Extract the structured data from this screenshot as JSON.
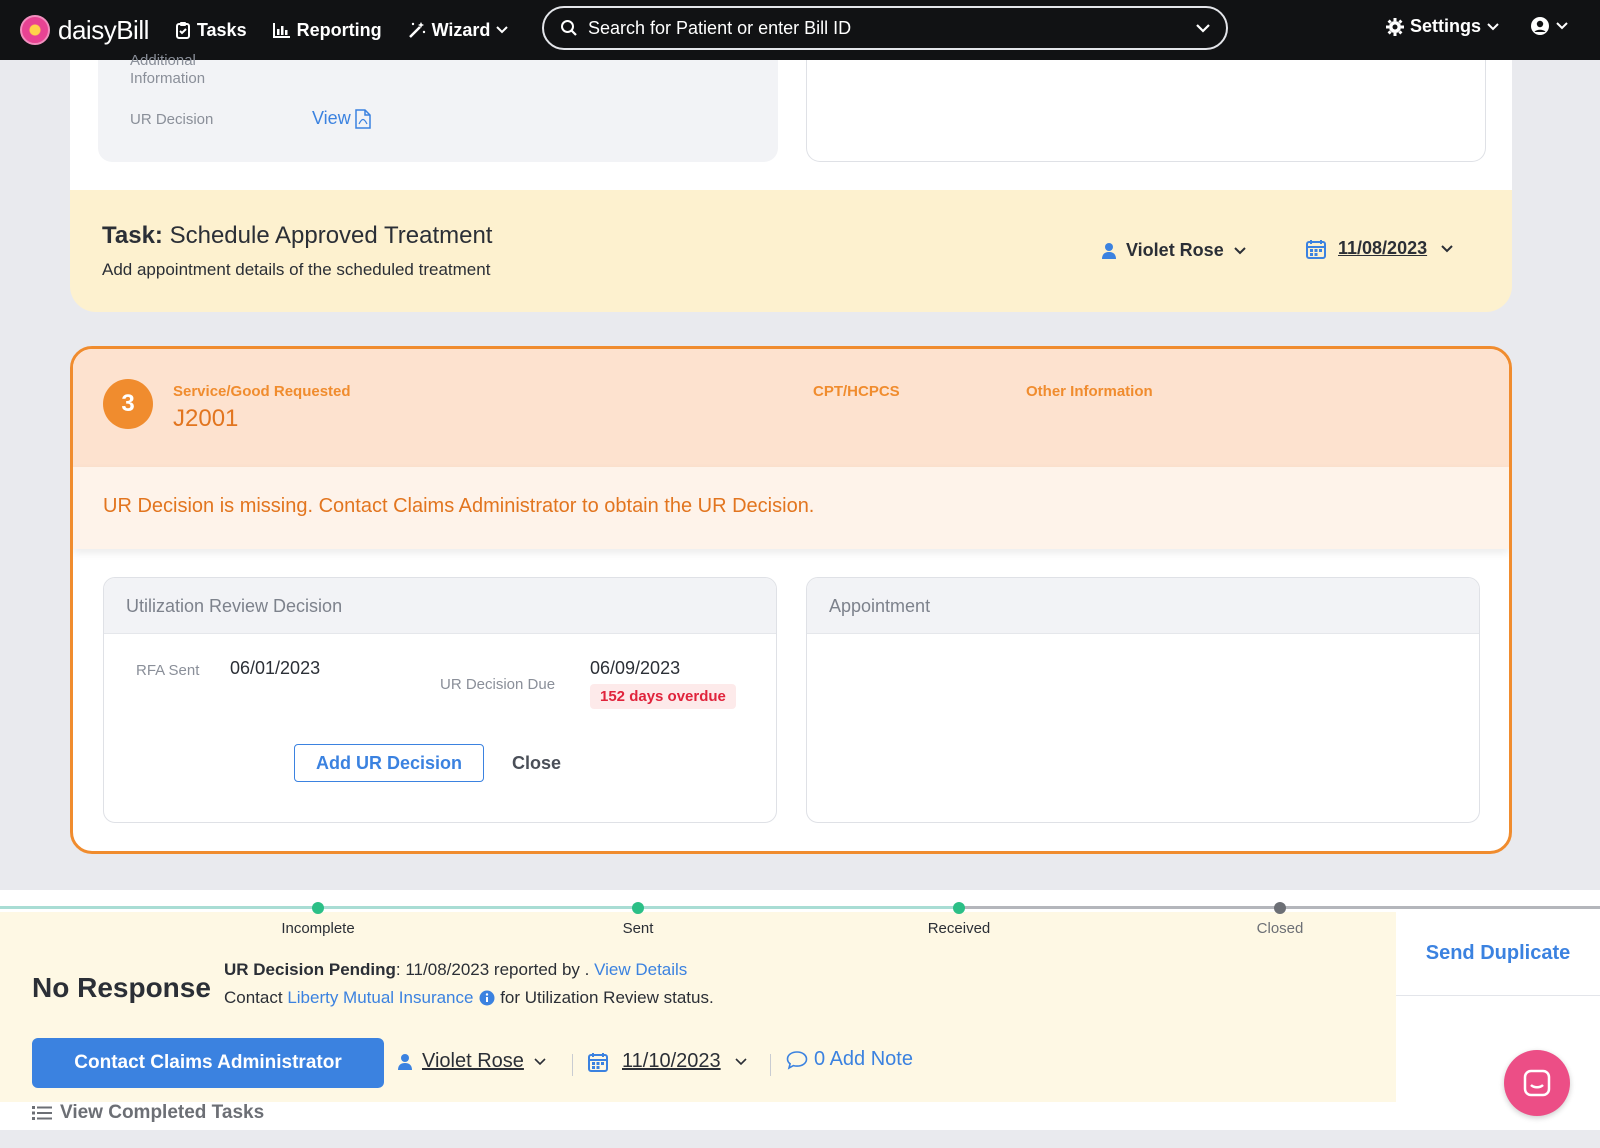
{
  "nav": {
    "brand": "daisyBill",
    "tasks": "Tasks",
    "reporting": "Reporting",
    "wizard": "Wizard",
    "search_placeholder": "Search for Patient or enter Bill ID",
    "settings": "Settings"
  },
  "prev_card": {
    "additional_information": "Additional Information",
    "ur_decision_label": "UR Decision",
    "view_link": "View"
  },
  "task": {
    "prefix": "Task:",
    "title": "Schedule Approved Treatment",
    "subtitle": "Add appointment details of the scheduled treatment",
    "assignee": "Violet Rose",
    "due_date": "11/08/2023"
  },
  "request": {
    "number": "3",
    "service_label": "Service/Good Requested",
    "service_value": "J2001",
    "cpt_label": "CPT/HCPCS",
    "other_label": "Other Information",
    "warning": "UR Decision is missing. Contact Claims Administrator to obtain the UR Decision.",
    "ur_panel": {
      "title": "Utilization Review Decision",
      "rfa_sent_label": "RFA Sent",
      "rfa_sent_value": "06/01/2023",
      "due_label": "UR Decision Due",
      "due_value": "06/09/2023",
      "overdue": "152 days overdue",
      "add_button": "Add UR Decision",
      "close_button": "Close"
    },
    "appointment_panel": {
      "title": "Appointment"
    }
  },
  "status": {
    "steps": [
      {
        "label": "Incomplete",
        "state": "done"
      },
      {
        "label": "Sent",
        "state": "done"
      },
      {
        "label": "Received",
        "state": "done"
      },
      {
        "label": "Closed",
        "state": "todo"
      }
    ],
    "title": "No Response",
    "pending_label": "UR Decision Pending",
    "pending_text": ": 11/08/2023 reported by . ",
    "view_details": "View Details",
    "contact_prefix": "Contact ",
    "administrator": "Liberty Mutual Insurance",
    "contact_suffix": " for Utilization Review status.",
    "action_button": "Contact Claims Administrator",
    "assignee": "Violet Rose",
    "due_date": "11/10/2023",
    "add_note": "0 Add Note",
    "send_duplicate": "Send Duplicate",
    "view_completed": "View Completed Tasks"
  },
  "colors": {
    "accent_blue": "#3b82e0",
    "brand_orange": "#f08c2e",
    "overdue_red": "#e0243c",
    "task_yellow": "#fdf1cf",
    "chat_pink": "#ec4e86"
  }
}
